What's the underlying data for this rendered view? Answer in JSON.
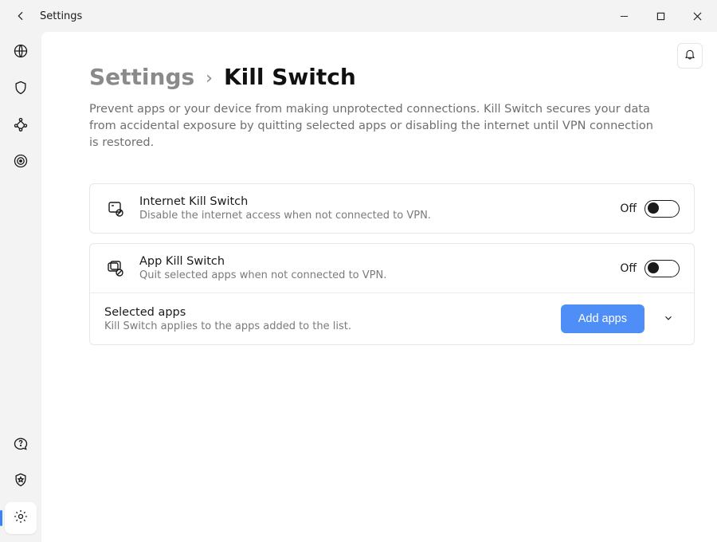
{
  "titlebar": {
    "title": "Settings"
  },
  "breadcrumb": {
    "prev": "Settings",
    "sep": "›",
    "current": "Kill Switch"
  },
  "description": "Prevent apps or your device from making unprotected connections. Kill Switch secures your data from accidental exposure by quitting selected apps or disabling the internet until VPN connection is restored.",
  "internet_ks": {
    "title": "Internet Kill Switch",
    "subtitle": "Disable the internet access when not connected to VPN.",
    "state_label": "Off"
  },
  "app_ks": {
    "title": "App Kill Switch",
    "subtitle": "Quit selected apps when not connected to VPN.",
    "state_label": "Off"
  },
  "selected_apps": {
    "title": "Selected apps",
    "subtitle": "Kill Switch applies to the apps added to the list.",
    "add_button": "Add apps"
  },
  "colors": {
    "accent": "#4f8ef7"
  }
}
